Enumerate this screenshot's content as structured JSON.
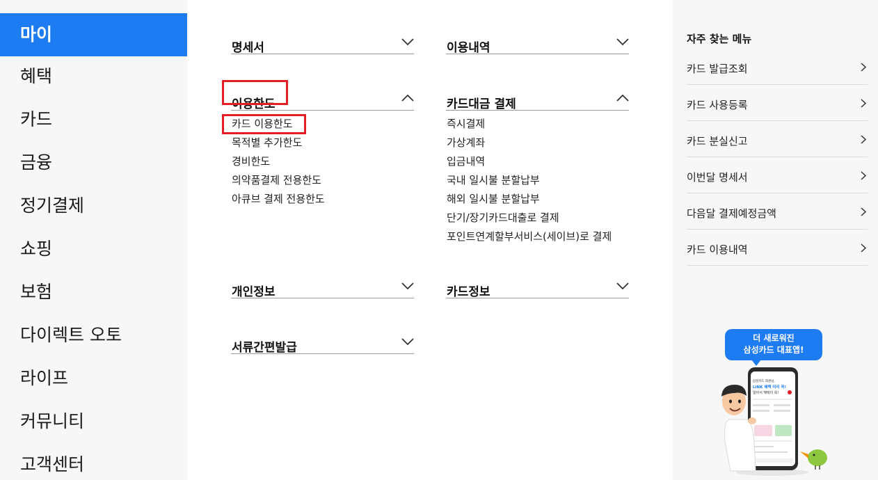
{
  "left_nav": {
    "items": [
      {
        "label": "마이",
        "active": true
      },
      {
        "label": "혜택"
      },
      {
        "label": "카드"
      },
      {
        "label": "금융"
      },
      {
        "label": "정기결제"
      },
      {
        "label": "쇼핑"
      },
      {
        "label": "보험"
      },
      {
        "label": "다이렉트 오토"
      },
      {
        "label": "라이프"
      },
      {
        "label": "커뮤니티"
      },
      {
        "label": "고객센터"
      }
    ]
  },
  "sections": {
    "statement": {
      "title": "명세서",
      "expanded": false
    },
    "usage_history": {
      "title": "이용내역",
      "expanded": false
    },
    "usage_limit": {
      "title": "이용한도",
      "expanded": true,
      "items": [
        "카드 이용한도",
        "목적별 추가한도",
        "경비한도",
        "의약품결제 전용한도",
        "아큐브 결제 전용한도"
      ]
    },
    "payment": {
      "title": "카드대금 결제",
      "expanded": true,
      "items": [
        "즉시결제",
        "가상계좌",
        "입금내역",
        "국내 일시불 분할납부",
        "해외 일시불 분할납부",
        "단기/장기카드대출로 결제",
        "포인트연계할부서비스(세이브)로 결제"
      ]
    },
    "personal_info": {
      "title": "개인정보",
      "expanded": false
    },
    "card_info": {
      "title": "카드정보",
      "expanded": false
    },
    "document_issue": {
      "title": "서류간편발급",
      "expanded": false
    }
  },
  "quick_menu": {
    "title": "자주 찾는 메뉴",
    "items": [
      "카드 발급조회",
      "카드 사용등록",
      "카드 분실신고",
      "이번달 명세서",
      "다음달 결제예정금액",
      "카드 이용내역"
    ]
  },
  "promo": {
    "line1": "더 새로워진",
    "line2": "삼성카드 대표앱!",
    "phone_greeting": "삼성카드 회원님,",
    "phone_headline1": "LINK 혜택 미리 꼭!",
    "phone_headline2": "알아서 혜택이 쏙!"
  },
  "colors": {
    "accent": "#1e7cf2",
    "highlight_box": "#e31e24",
    "panel_bg": "#f7f7f7"
  }
}
